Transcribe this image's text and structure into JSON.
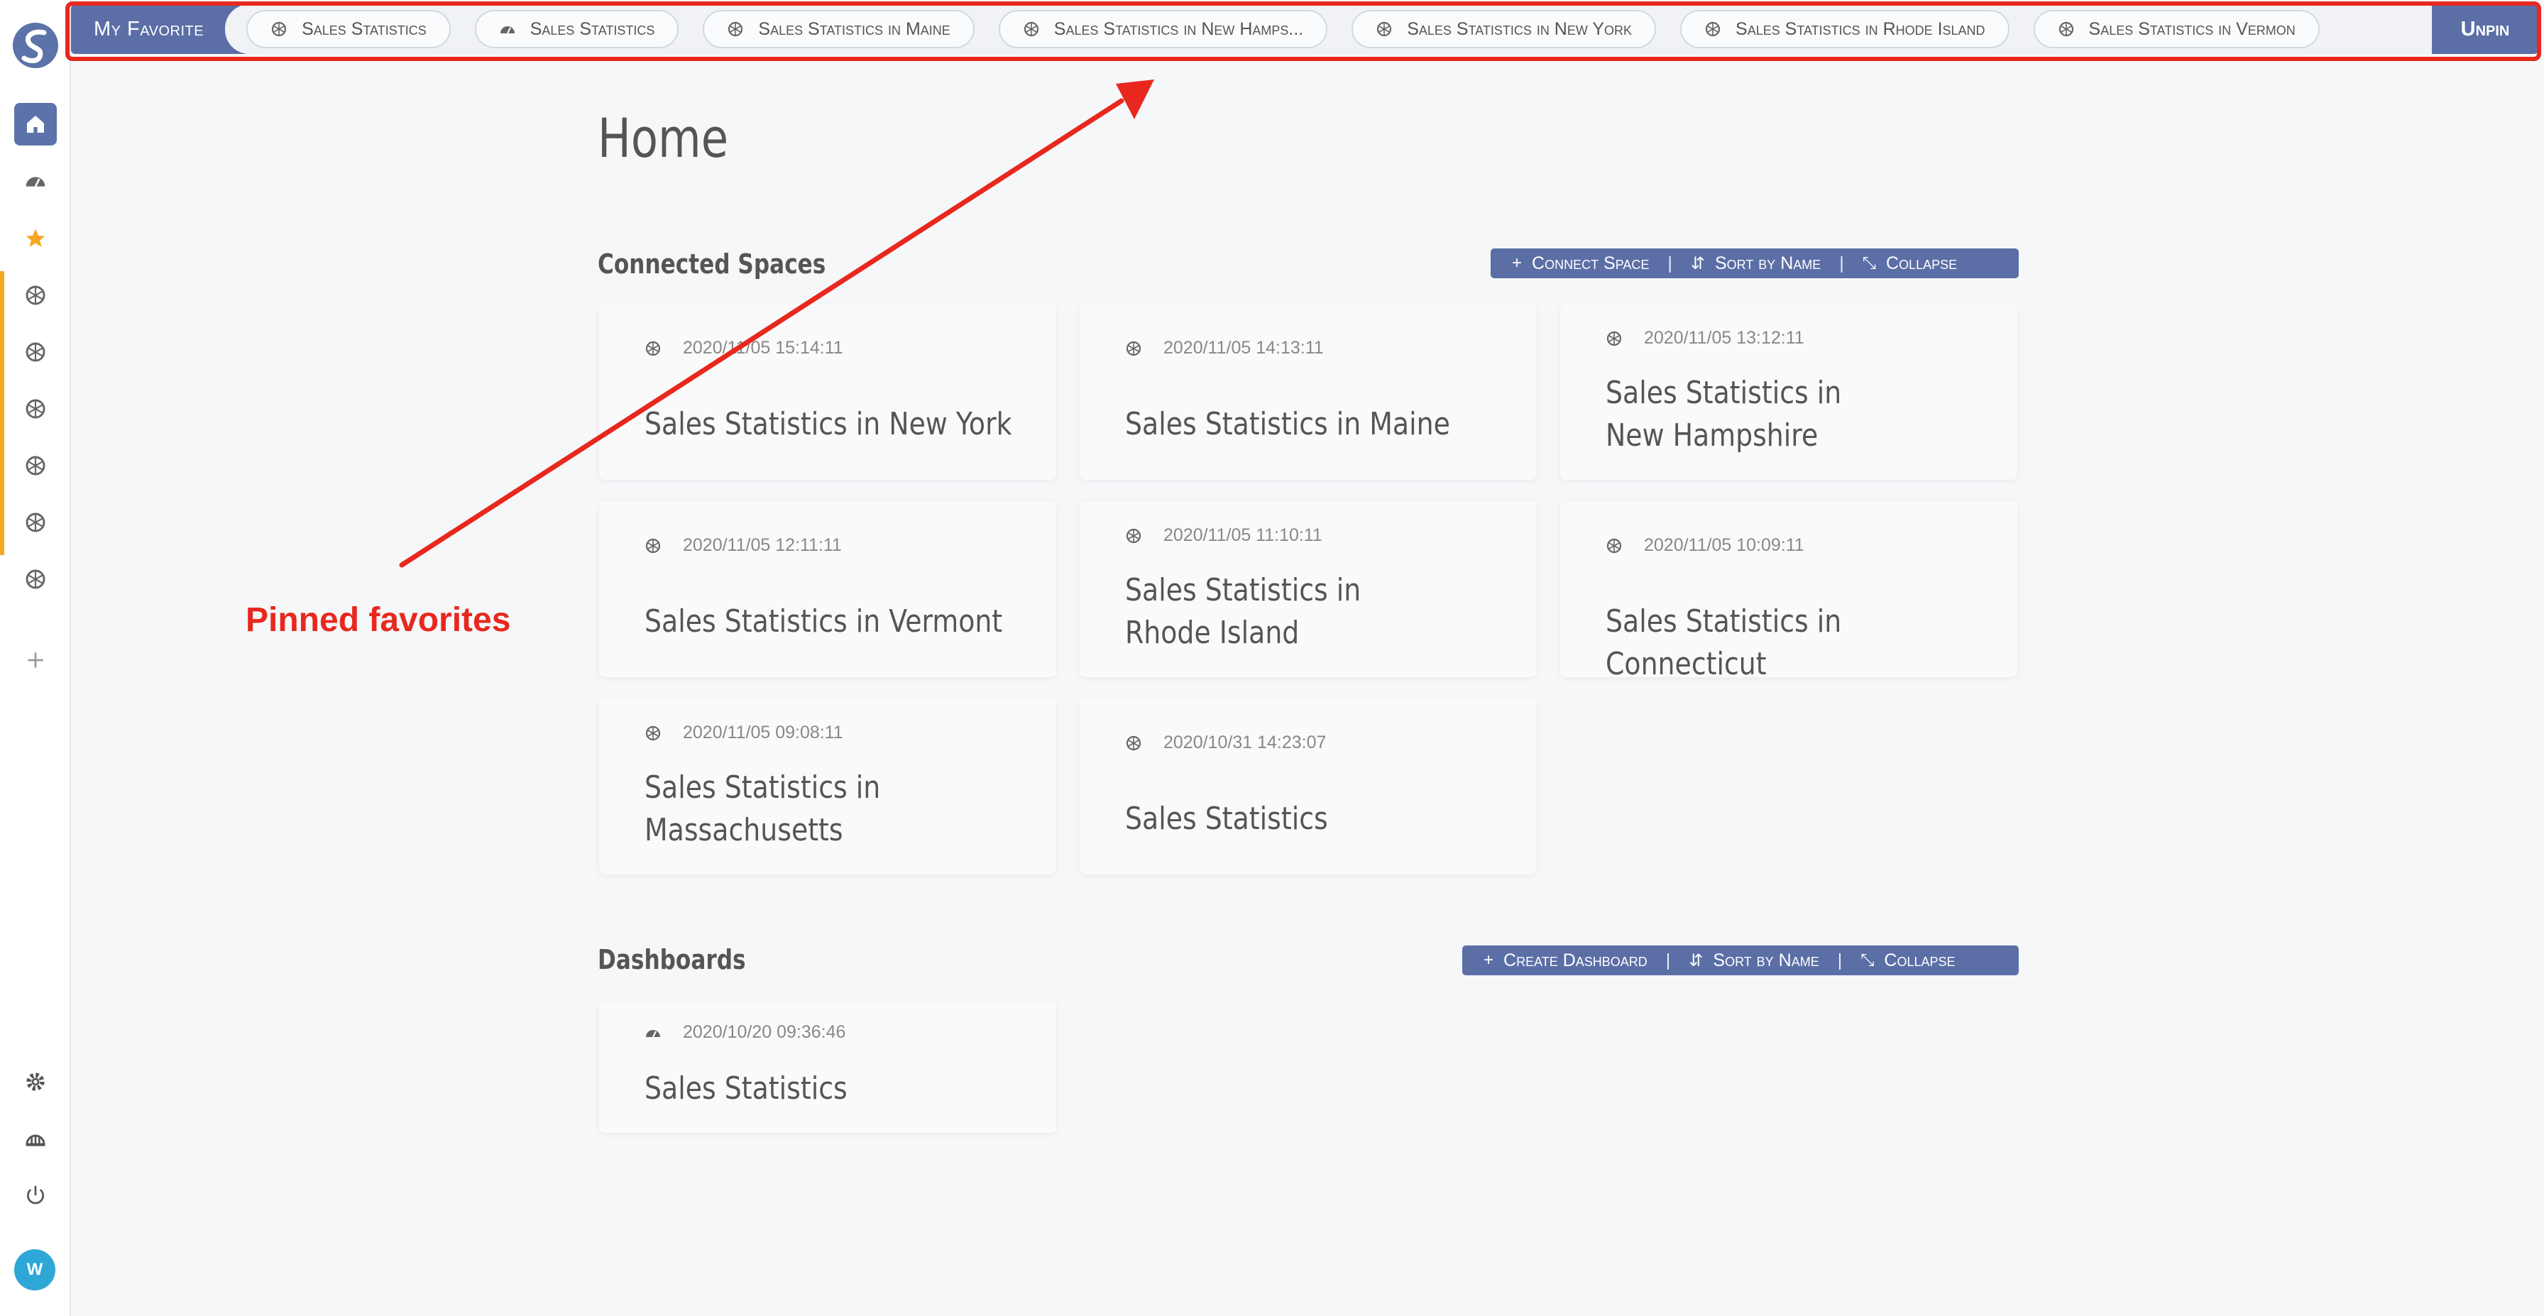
{
  "favorites": {
    "title": "My Favorite",
    "unpin": "Unpin",
    "items": [
      {
        "label": "Sales Statistics",
        "icon": "space-icon"
      },
      {
        "label": "Sales Statistics",
        "icon": "dashboard-icon"
      },
      {
        "label": "Sales Statistics in Maine",
        "icon": "space-icon"
      },
      {
        "label": "Sales Statistics in New Hamps...",
        "icon": "space-icon"
      },
      {
        "label": "Sales Statistics in New York",
        "icon": "space-icon"
      },
      {
        "label": "Sales Statistics in Rhode Island",
        "icon": "space-icon"
      },
      {
        "label": "Sales Statistics in Vermon",
        "icon": "space-icon"
      }
    ]
  },
  "page": {
    "title": "Home"
  },
  "connected_spaces": {
    "title": "Connected Spaces",
    "actions": {
      "connect": "Connect Space",
      "sort": "Sort by Name",
      "collapse": "Collapse"
    },
    "cards": [
      {
        "time": "2020/11/05 15:14:11",
        "name": "Sales Statistics in New York"
      },
      {
        "time": "2020/11/05 14:13:11",
        "name": "Sales Statistics in Maine"
      },
      {
        "time": "2020/11/05 13:12:11",
        "name": "Sales Statistics in New Hampshire"
      },
      {
        "time": "2020/11/05 12:11:11",
        "name": "Sales Statistics in Vermont"
      },
      {
        "time": "2020/11/05 11:10:11",
        "name": "Sales Statistics in Rhode Island"
      },
      {
        "time": "2020/11/05 10:09:11",
        "name": "Sales Statistics in Connecticut"
      },
      {
        "time": "2020/11/05 09:08:11",
        "name": "Sales Statistics in Massachusetts"
      },
      {
        "time": "2020/10/31 14:23:07",
        "name": "Sales Statistics"
      }
    ]
  },
  "dashboards": {
    "title": "Dashboards",
    "actions": {
      "create": "Create Dashboard",
      "sort": "Sort by Name",
      "collapse": "Collapse"
    },
    "cards": [
      {
        "time": "2020/10/20 09:36:46",
        "name": "Sales Statistics"
      }
    ]
  },
  "annotation": {
    "label": "Pinned favorites",
    "color": "#e8281e"
  },
  "user": {
    "avatar_initials": "W"
  },
  "colors": {
    "accent": "#5b6ea6",
    "favorite_star": "#f5a623"
  }
}
